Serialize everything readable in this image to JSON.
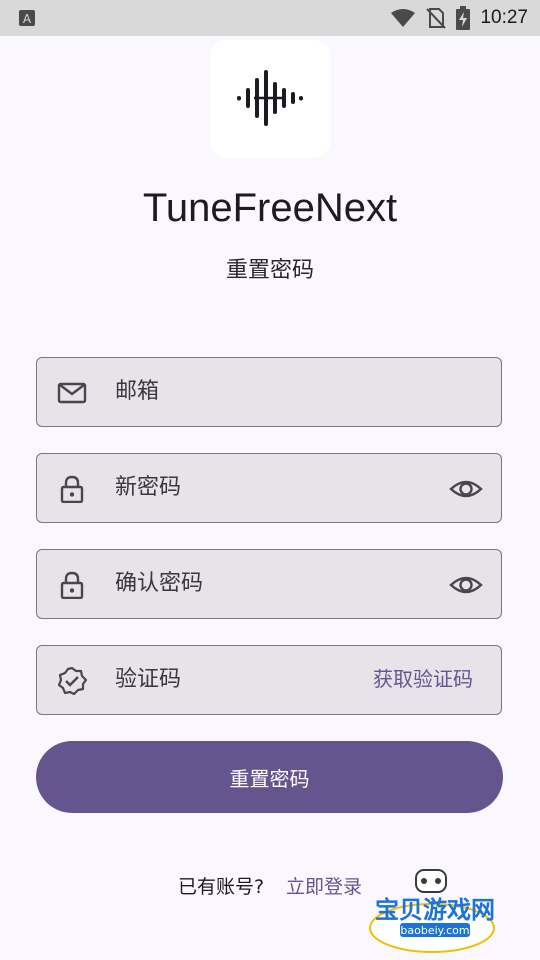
{
  "status_bar": {
    "time": "10:27",
    "icons": [
      "notification-a-icon",
      "wifi-icon",
      "no-sim-icon",
      "battery-charging-icon"
    ]
  },
  "app": {
    "title": "TuneFreeNext",
    "subtitle": "重置密码"
  },
  "form": {
    "email": {
      "placeholder": "邮箱",
      "value": "",
      "icon": "mail-icon"
    },
    "new_password": {
      "placeholder": "新密码",
      "value": "",
      "icon": "lock-icon",
      "toggle_icon": "eye-icon"
    },
    "confirm_password": {
      "placeholder": "确认密码",
      "value": "",
      "icon": "lock-icon",
      "toggle_icon": "eye-icon"
    },
    "code": {
      "placeholder": "验证码",
      "value": "",
      "icon": "verified-badge-icon",
      "get_code_label": "获取验证码"
    },
    "submit_label": "重置密码"
  },
  "footer": {
    "question": "已有账号?",
    "login_link": "立即登录"
  },
  "watermark": {
    "title": "宝贝游戏网",
    "url": "baobeiy.com"
  },
  "colors": {
    "background": "#FBF7FE",
    "primary": "#65558F",
    "field_bg": "#E7E3E9",
    "field_border": "#7A757F",
    "status_bar": "#D9D9D9"
  }
}
